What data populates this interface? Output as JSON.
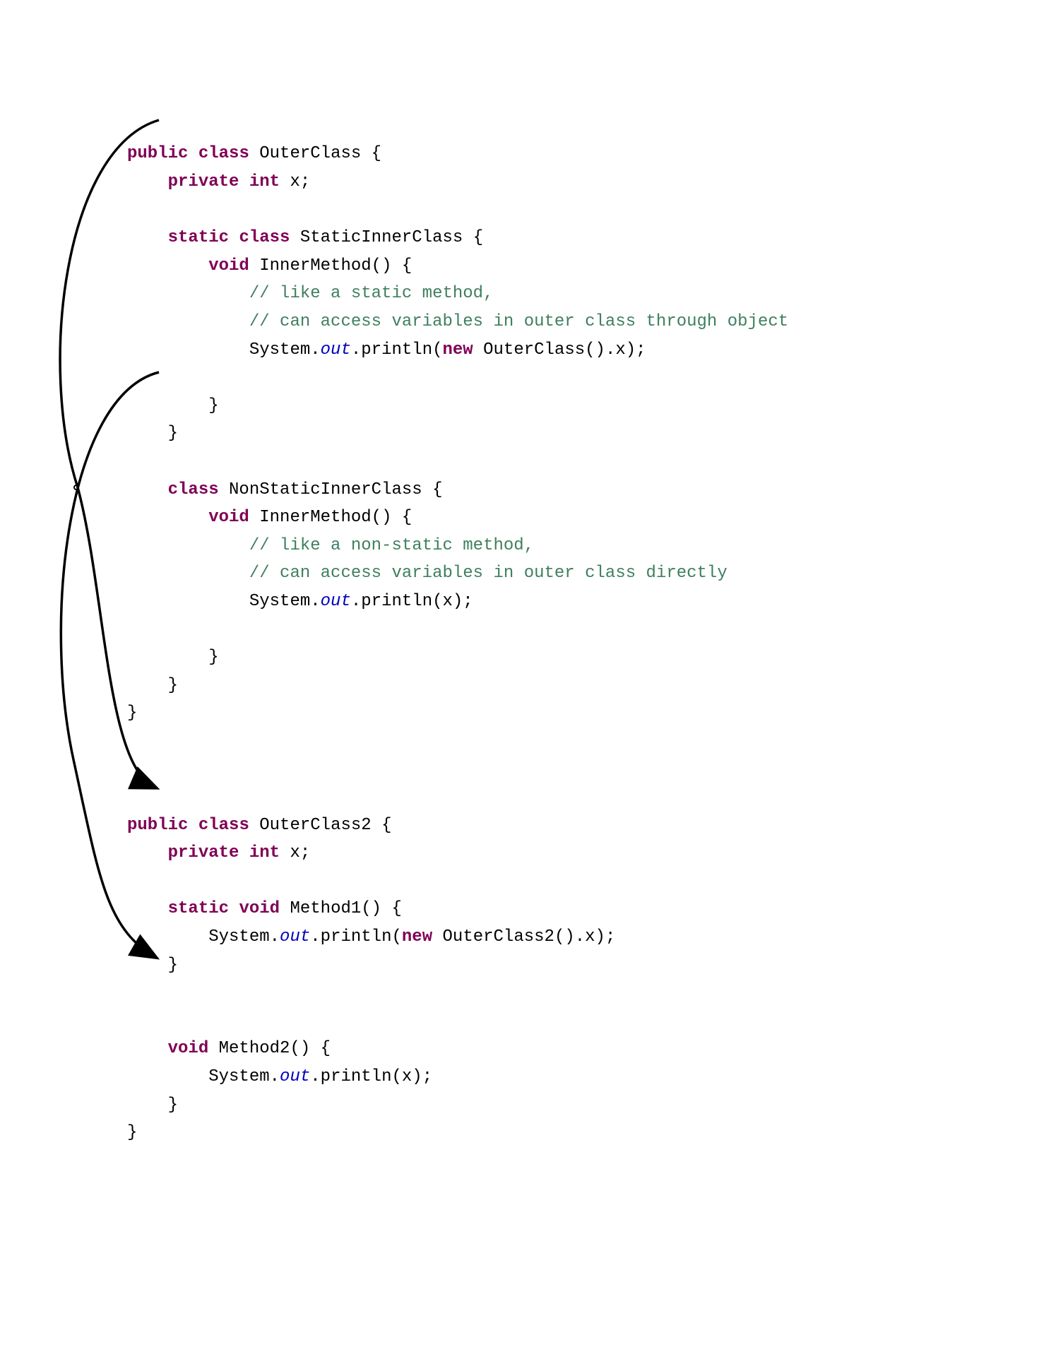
{
  "code": {
    "outerClass": {
      "decl": {
        "public": "public",
        "classKw": "class",
        "name": "OuterClass",
        "brace": " {"
      },
      "field": {
        "private": "private",
        "intKw": "int",
        "name": "x",
        "semi": ";"
      },
      "staticInner": {
        "decl": {
          "static": "static",
          "classKw": "class",
          "name": "StaticInnerClass",
          "brace": " {"
        },
        "method": {
          "voidKw": "void",
          "name": "InnerMethod()",
          "brace": " {",
          "comment1": "// like a static method,",
          "comment2": "// can access variables in outer class through object",
          "stmt": {
            "system": "System.",
            "out": "out",
            "println": ".println(",
            "newKw": "new",
            "rest": " OuterClass().x);"
          },
          "close": "}"
        },
        "close": "}"
      },
      "nonStaticInner": {
        "decl": {
          "classKw": "class",
          "name": "NonStaticInnerClass",
          "brace": " {"
        },
        "method": {
          "voidKw": "void",
          "name": "InnerMethod()",
          "brace": " {",
          "comment1": "// like a non-static method,",
          "comment2": "// can access variables in outer class directly",
          "stmt": {
            "system": "System.",
            "out": "out",
            "println": ".println(x);"
          },
          "close": "}"
        },
        "close": "}"
      },
      "close": "}"
    },
    "outerClass2": {
      "decl": {
        "public": "public",
        "classKw": "class",
        "name": "OuterClass2",
        "brace": " {"
      },
      "field": {
        "private": "private",
        "intKw": "int",
        "name": "x",
        "semi": ";"
      },
      "method1": {
        "staticKw": "static",
        "voidKw": "void",
        "name": "Method1()",
        "brace": " {",
        "stmt": {
          "system": "System.",
          "out": "out",
          "println": ".println(",
          "newKw": "new",
          "rest": " OuterClass2().x);"
        },
        "close": "}"
      },
      "method2": {
        "voidKw": "void",
        "name": "Method2()",
        "brace": " {",
        "stmt": {
          "system": "System.",
          "out": "out",
          "println": ".println(x);"
        },
        "close": "}"
      },
      "close": "}"
    }
  }
}
